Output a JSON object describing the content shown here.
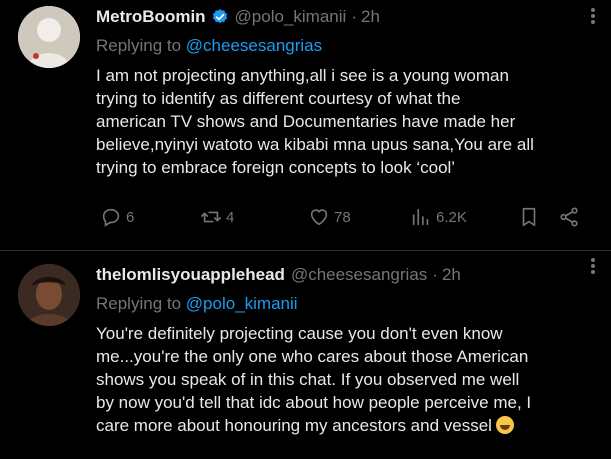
{
  "tweets": [
    {
      "display_name": "MetroBoomin",
      "handle": "@polo_kimanii",
      "separator": "·",
      "time": "2h",
      "replying_prefix": "Replying to",
      "replying_to": "@cheesesangrias",
      "text": "I am not projecting anything,all i see is a young woman\ntrying to identify as different courtesy of what the\namerican TV shows and Documentaries have made her\nbelieve,nyinyi watoto wa kibabi mna upus sana,You are all\ntrying to embrace foreign concepts to look ‘cool’",
      "verified": true,
      "actions": {
        "replies": "6",
        "retweets": "4",
        "likes": "78",
        "views": "6.2K"
      }
    },
    {
      "display_name": "thelomlisyouapplehead",
      "handle": "@cheesesangrias",
      "separator": "·",
      "time": "2h",
      "replying_prefix": "Replying to",
      "replying_to": "@polo_kimanii",
      "text": "You're definitely projecting cause you don't even know\nme...you're the only one who cares about those American\nshows you speak of in this chat. If you observed me well\nby now you'd tell that idc about how people perceive me, I\ncare more about honouring my ancestors and vessel",
      "emoji": "grinning-sweat-emoji"
    }
  ],
  "colors": {
    "background": "#000000",
    "text": "#e7e9ea",
    "muted": "#71767b",
    "accent": "#1d9bf0"
  },
  "icons": [
    "verified-badge-icon",
    "more-icon",
    "reply-icon",
    "retweet-icon",
    "like-icon",
    "views-icon",
    "bookmark-icon",
    "share-icon"
  ]
}
